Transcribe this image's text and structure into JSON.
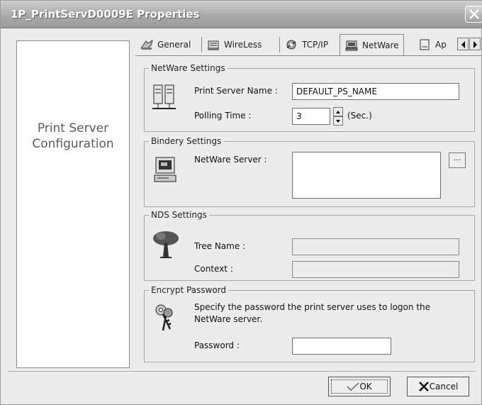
{
  "window": {
    "title": "1P_PrintServD0009E Properties"
  },
  "sidebar": {
    "line1": "Print Server",
    "line2": "Configuration"
  },
  "tabs": [
    {
      "label": "General",
      "icon": "general-icon"
    },
    {
      "label": "WireLess",
      "icon": "wireless-icon"
    },
    {
      "label": "TCP/IP",
      "icon": "tcpip-icon"
    },
    {
      "label": "NetWare",
      "icon": "netware-icon",
      "active": true
    },
    {
      "label": "Ap",
      "icon": "appletalk-icon"
    }
  ],
  "netware_settings": {
    "title": "NetWare Settings",
    "server_name_label": "Print Server Name :",
    "server_name_value": "DEFAULT_PS_NAME",
    "polling_label": "Polling Time :",
    "polling_value": "3",
    "polling_unit": "(Sec.)"
  },
  "bindery": {
    "title": "Bindery Settings",
    "server_label": "NetWare Server :",
    "browse_label": "..."
  },
  "nds": {
    "title": "NDS Settings",
    "tree_label": "Tree Name :",
    "tree_value": "",
    "context_label": "Context :",
    "context_value": ""
  },
  "encrypt": {
    "title": "Encrypt Password",
    "desc_line1": "Specify the password the print server uses to logon the",
    "desc_line2": "NetWare server.",
    "password_label": "Password :",
    "password_value": ""
  },
  "buttons": {
    "ok": "OK",
    "cancel": "Cancel"
  }
}
